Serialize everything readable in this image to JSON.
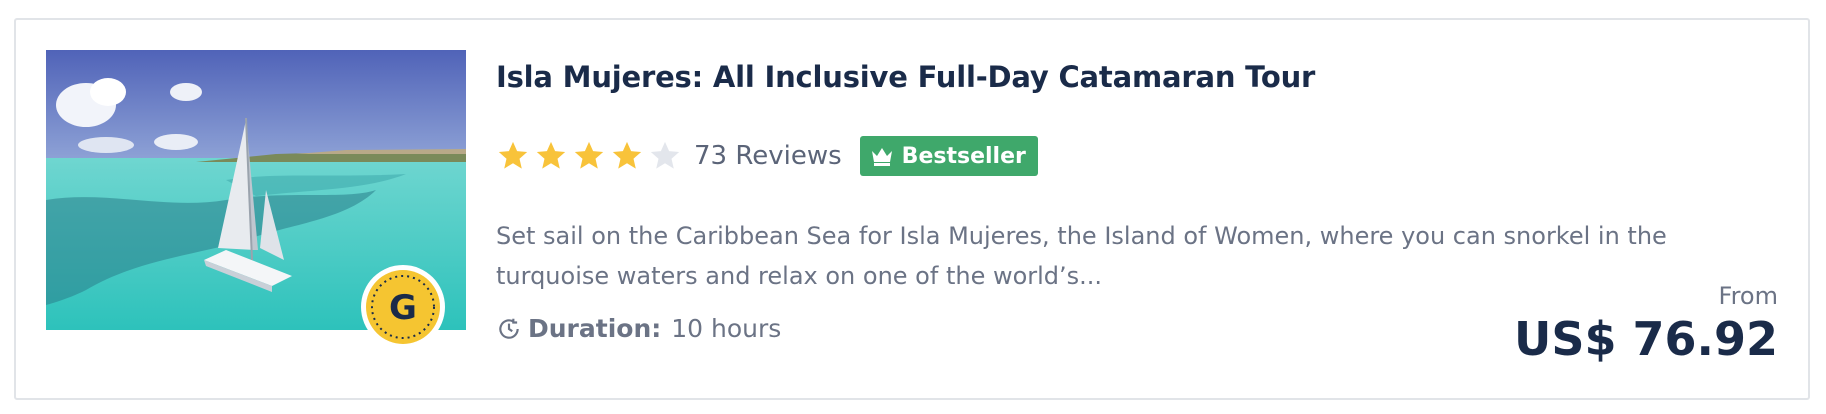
{
  "tour": {
    "title": "Isla Mujeres: All Inclusive Full-Day Catamaran Tour",
    "rating_stars": 4,
    "max_stars": 5,
    "reviews_label": "73 Reviews",
    "bestseller_label": "Bestseller",
    "description": "Set sail on the Caribbean Sea for Isla Mujeres, the Island of Women, where you can snorkel in the turquoise waters and relax on one of the world’s...",
    "duration_label": "Duration:",
    "duration_value": "10 hours",
    "price_prefix": "From",
    "price": "US$ 76.92",
    "badge_letter": "G"
  },
  "colors": {
    "title": "#1a2b49",
    "star_filled": "#f8c33a",
    "star_empty": "#e3e6ec",
    "bestseller_bg": "#3fa86b",
    "badge_gold": "#f5c531"
  },
  "icons": {
    "bestseller": "crown-icon",
    "duration": "clock-icon",
    "badge": "gold-g-badge-icon"
  }
}
